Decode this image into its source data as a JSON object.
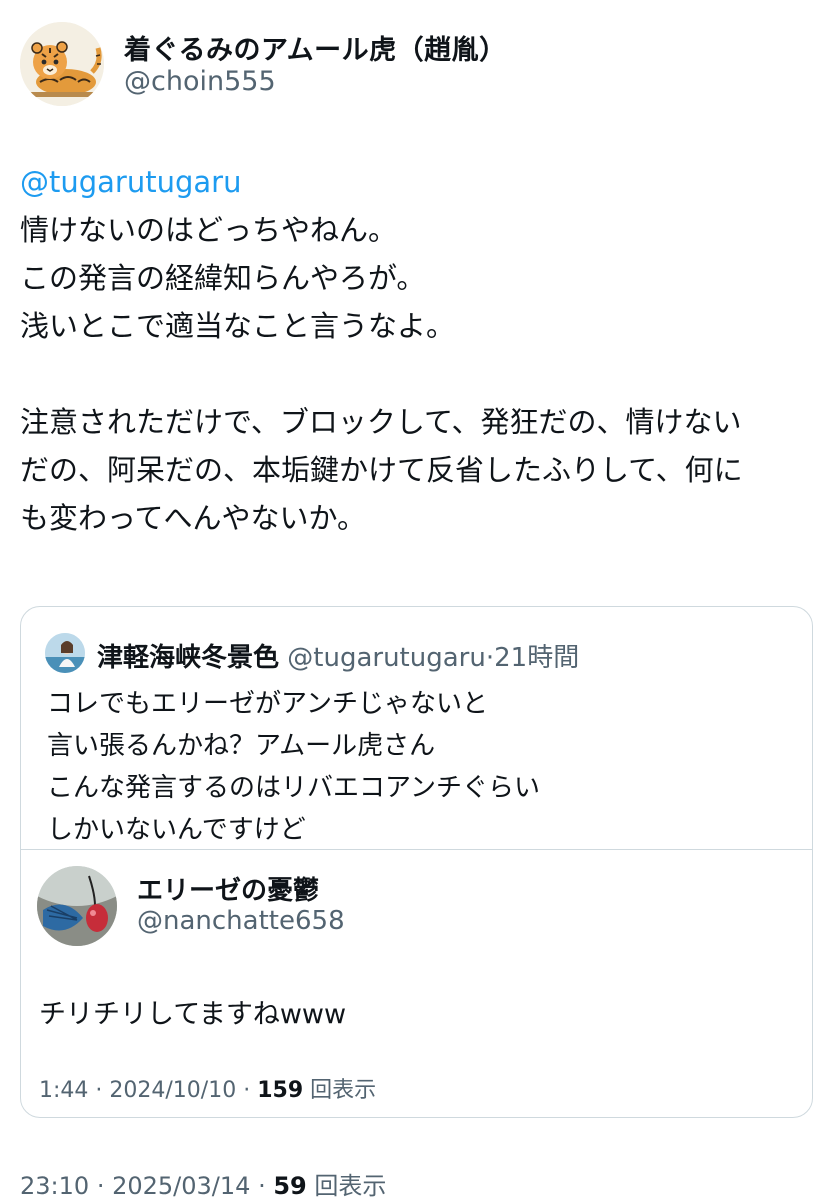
{
  "author": {
    "display_name": "着ぐるみのアムール虎（趙胤）",
    "handle": "@choin555",
    "avatar_icon": "tiger-illustration-icon"
  },
  "tweet": {
    "mention": "@tugarutugaru",
    "lines_1": [
      "情けないのはどっちやねん。",
      "この発言の経緯知らんやろが。",
      "浅いとこで適当なこと言うなよ。"
    ],
    "lines_2": [
      "注意されただけで、ブロックして、発狂だの、情けない",
      "だの、阿呆だの、本垢鍵かけて反省したふりして、何に",
      "も変わってへんやないか。"
    ]
  },
  "quote": {
    "display_name": "津軽海峡冬景色",
    "handle": "@tugarutugaru",
    "separator": "·",
    "time": "21時間",
    "lines": [
      "コレでもエリーゼがアンチじゃないと",
      "言い張るんかね？アムール虎さん",
      "こんな発言するのはリバエコアンチぐらい",
      "しかいないんですけど"
    ],
    "inner": {
      "display_name": "エリーゼの憂鬱",
      "handle": "@nanchatte658",
      "text": "チリチリしてますねwww",
      "time": "1:44",
      "date": "2024/10/10",
      "views": "159",
      "views_label": "回表示",
      "separator": "·"
    }
  },
  "footer": {
    "time": "23:10",
    "date": "2025/03/14",
    "views": "59",
    "views_label": "回表示",
    "separator": "·"
  },
  "colors": {
    "link": "#1d9bf0",
    "secondary_text": "#536471",
    "border": "#cfd9de"
  }
}
